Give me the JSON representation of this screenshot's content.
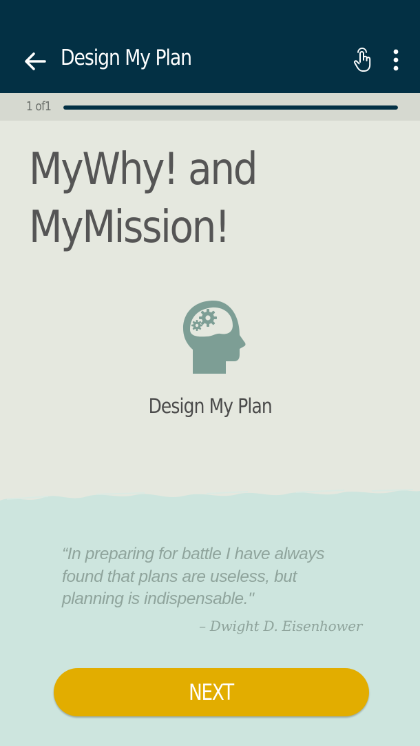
{
  "app_bar": {
    "title": "Design My Plan",
    "background": "#033044",
    "back_icon": "arrow-left-icon",
    "touch_icon": "touch-hand-icon",
    "more_icon": "more-vert-icon"
  },
  "progress": {
    "label": "1 of1",
    "fraction": 1.0
  },
  "page": {
    "title_line1": "MyWhy! and",
    "title_line2": "MyMission!",
    "icon": "head-gears-icon",
    "icon_caption": "Design My Plan"
  },
  "quote": {
    "text": "“In preparing for battle I have always found that plans are useless, but planning is indispensable.\"",
    "author": "– Dwight D. Eisenhower"
  },
  "next_button": {
    "label": "NEXT",
    "color": "#e2ad00"
  },
  "colors": {
    "background": "#e5e8df",
    "quote_panel": "#cde5de",
    "icon": "#7d9e95"
  }
}
